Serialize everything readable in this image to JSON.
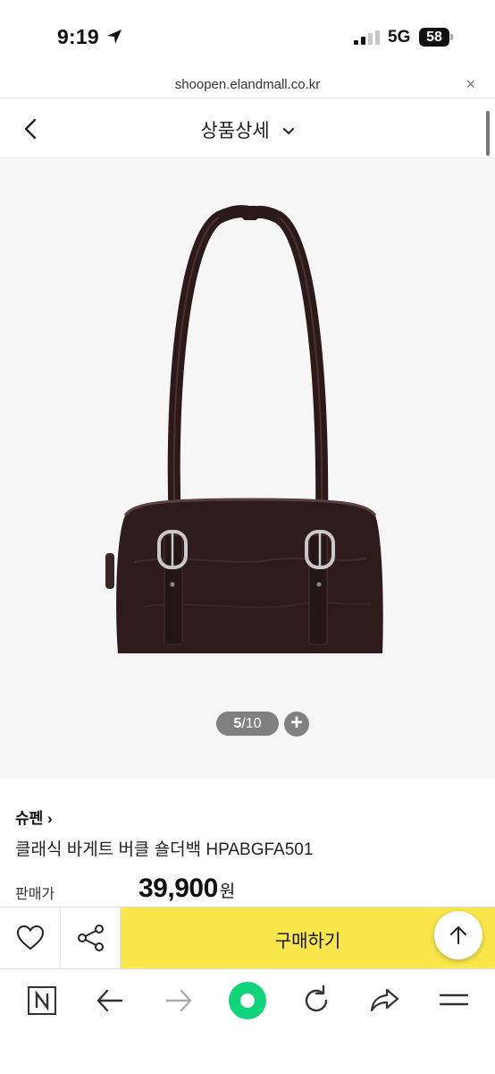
{
  "status_bar": {
    "time": "9:19",
    "network": "5G",
    "battery": "58",
    "icons": [
      "location-arrow-icon",
      "signal-bars-icon",
      "battery-icon"
    ]
  },
  "url_bar": {
    "url": "shoopen.elandmall.co.kr",
    "close_icon": "×"
  },
  "header": {
    "title": "상품상세",
    "icons": [
      "back-chevron-icon",
      "chevron-down-icon"
    ]
  },
  "gallery": {
    "current": "5",
    "total": "10",
    "separator": "/",
    "zoom_label": "+"
  },
  "product": {
    "brand": "슈펜 ›",
    "name": "클래식 바게트 버클 숄더백 HPABGFA501",
    "price_label": "판매가",
    "price": "39,900",
    "price_unit": "원"
  },
  "purchase_bar": {
    "buy_label": "구매하기",
    "icons": [
      "heart-icon",
      "share-icon",
      "arrow-up-icon"
    ]
  },
  "browser_toolbar": {
    "icons": [
      "naver-n-icon",
      "back-arrow-icon",
      "forward-arrow-icon",
      "home-dot-icon",
      "reload-icon",
      "share-arrow-icon",
      "menu-icon"
    ]
  },
  "colors": {
    "accent_yellow": "#f9e64a",
    "green": "#0fd47a",
    "bag": "#2b1a19"
  }
}
